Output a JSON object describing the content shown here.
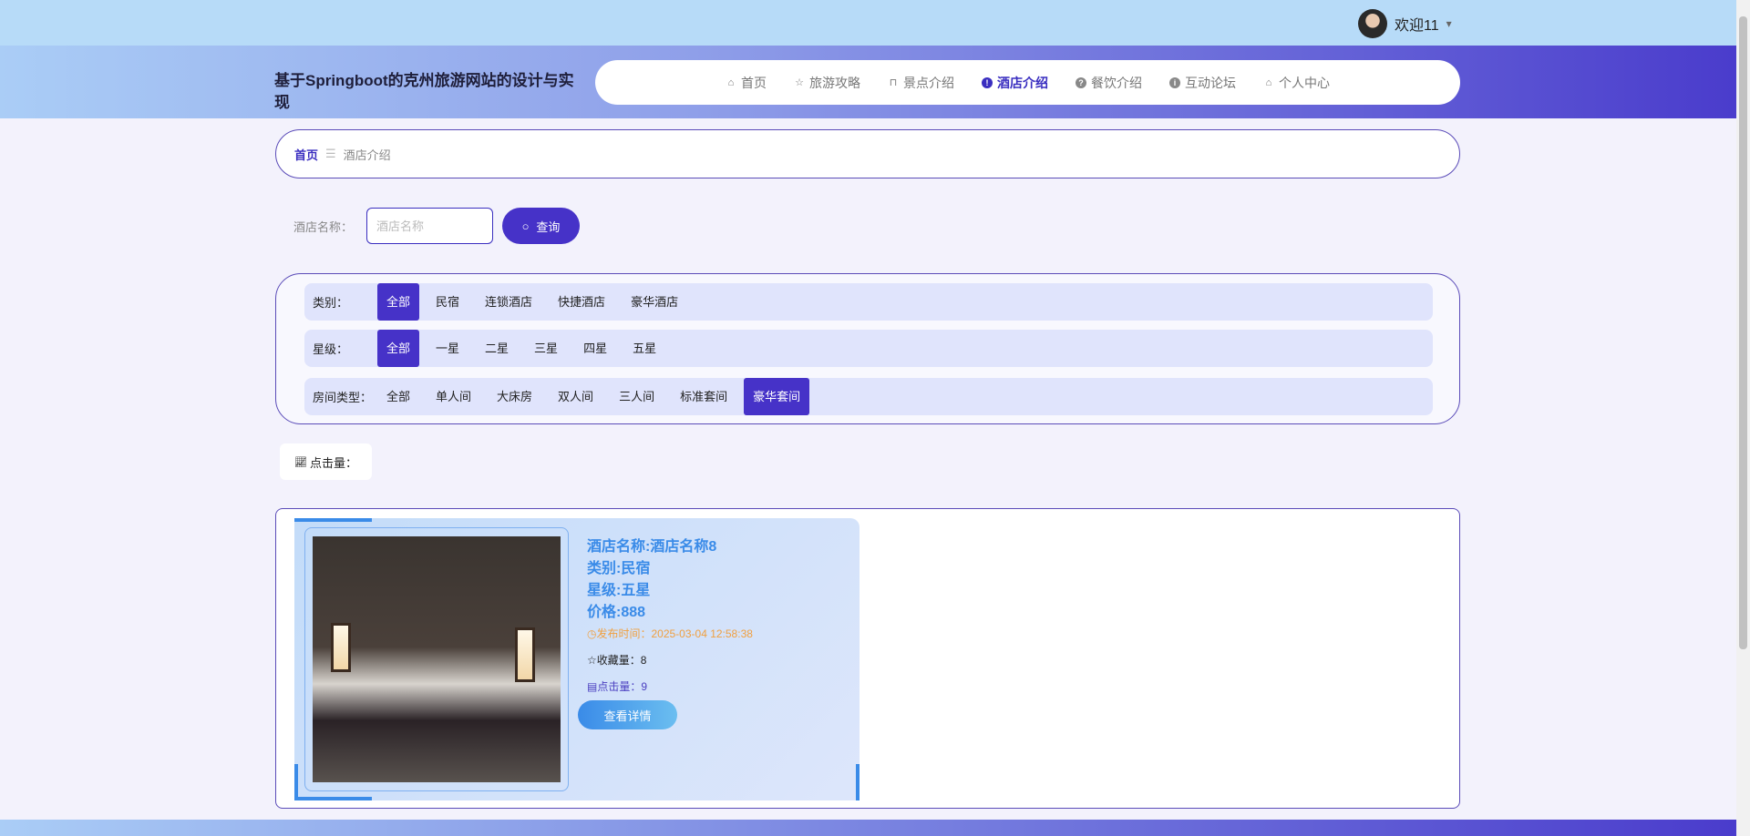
{
  "topbar": {
    "welcome": "欢迎11",
    "caret": "▾"
  },
  "header": {
    "title": "基于Springboot的克州旅游网站的设计与实现",
    "nav": [
      {
        "label": "首页",
        "icon": "⌂"
      },
      {
        "label": "旅游攻略",
        "icon": "☆"
      },
      {
        "label": "景点介绍",
        "icon": "⊓"
      },
      {
        "label": "酒店介绍",
        "icon": "!"
      },
      {
        "label": "餐饮介绍",
        "icon": "?"
      },
      {
        "label": "互动论坛",
        "icon": "i"
      },
      {
        "label": "个人中心",
        "icon": "⌂"
      }
    ]
  },
  "breadcrumb": {
    "home": "首页",
    "sep": "☰",
    "current": "酒店介绍"
  },
  "search": {
    "label": "酒店名称：",
    "placeholder": "酒店名称",
    "value": "",
    "button": "查询"
  },
  "filters": {
    "category": {
      "label": "类别：",
      "options": [
        "全部",
        "民宿",
        "连锁酒店",
        "快捷酒店",
        "豪华酒店"
      ],
      "selected": "全部"
    },
    "star": {
      "label": "星级：",
      "options": [
        "全部",
        "一星",
        "二星",
        "三星",
        "四星",
        "五星"
      ],
      "selected": "全部"
    },
    "room": {
      "label": "房间类型：",
      "options": [
        "全部",
        "单人间",
        "大床房",
        "双人间",
        "三人间",
        "标准套间",
        "豪华套间"
      ],
      "selected": "豪华套间"
    }
  },
  "sort": {
    "label": "点击量："
  },
  "card": {
    "name": "酒店名称:酒店名称8",
    "category": "类别:民宿",
    "star": "星级:五星",
    "price": "价格:888",
    "time": "发布时间：2025-03-04 12:58:38",
    "favorites": "收藏量：8",
    "clicks": "点击量：9",
    "button": "查看详情"
  }
}
